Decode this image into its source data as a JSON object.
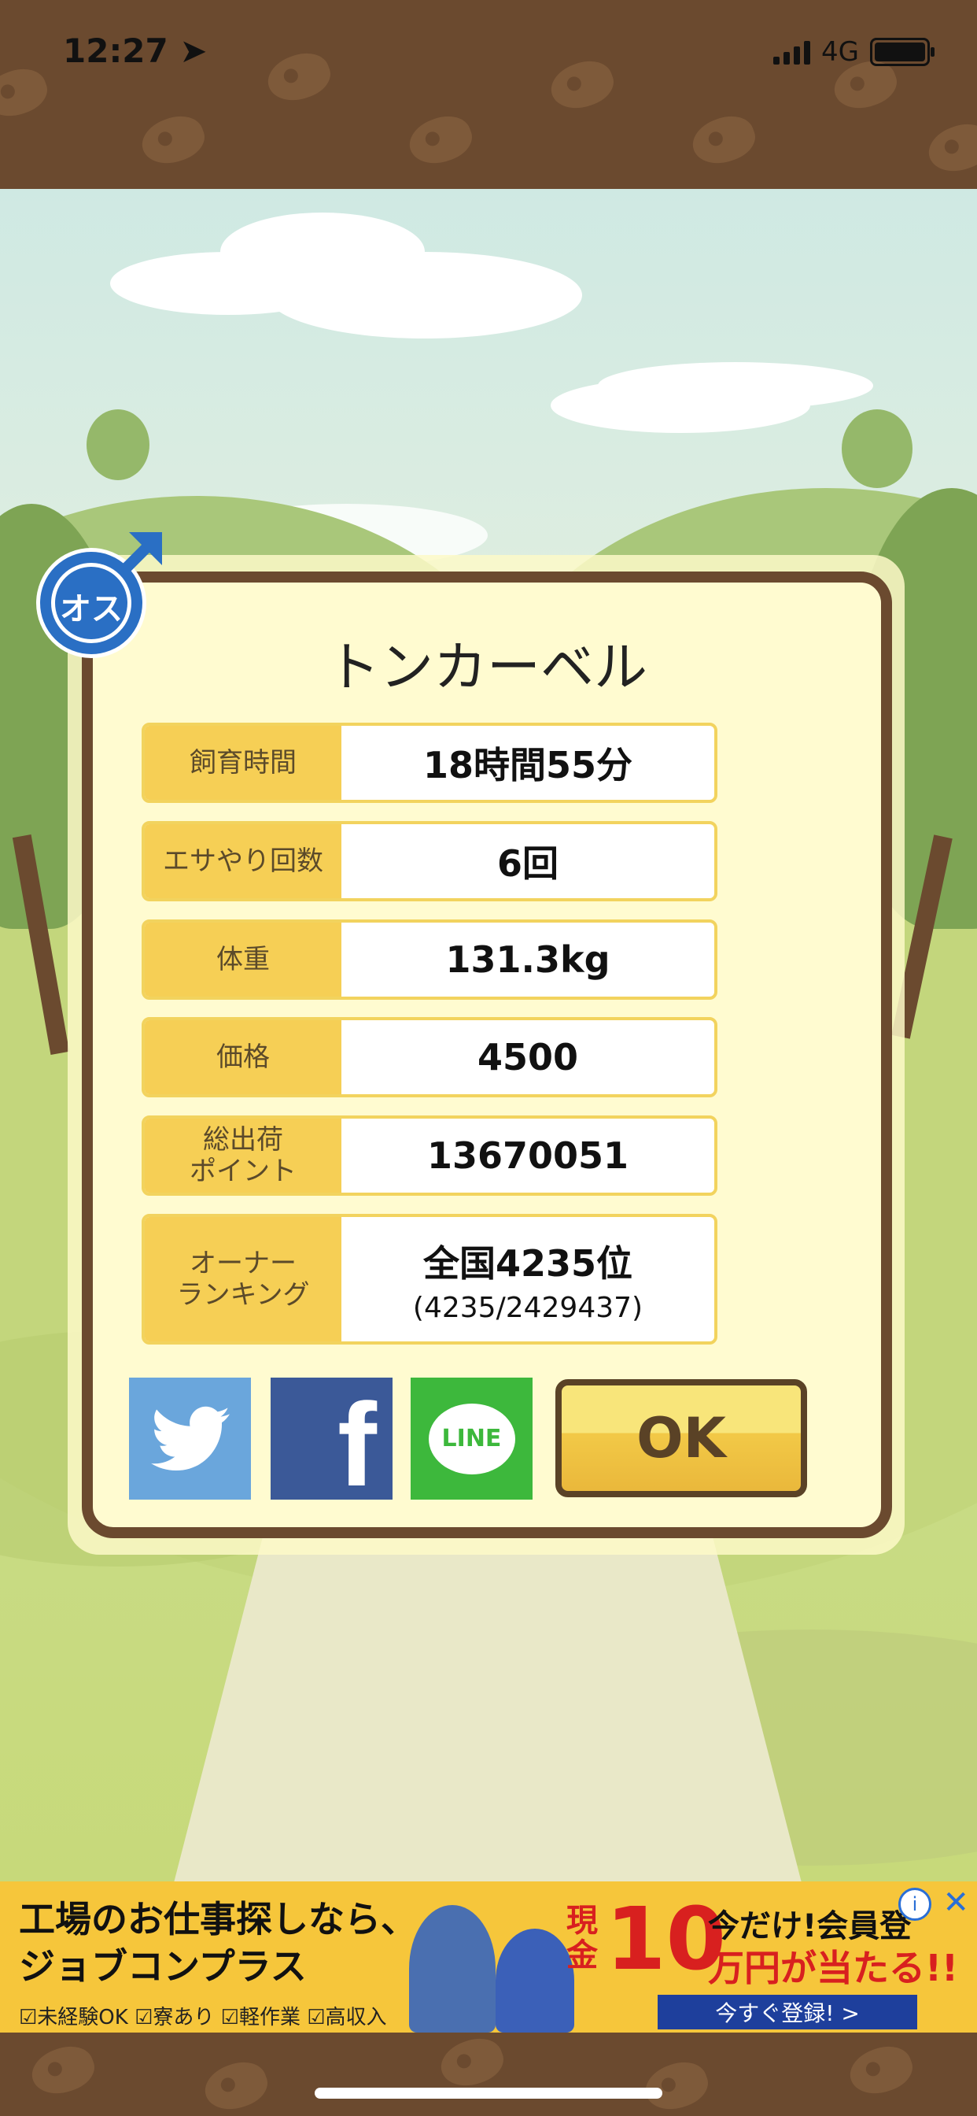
{
  "status_bar": {
    "time": "12:27",
    "network": "4G"
  },
  "dialog": {
    "title": "トンカーベル",
    "gender_badge": "オス",
    "rows": [
      {
        "label": "飼育時間",
        "value": "18時間55分"
      },
      {
        "label": "エサやり回数",
        "value": "6回"
      },
      {
        "label": "体重",
        "value": "131.3kg"
      },
      {
        "label": "価格",
        "value": "4500"
      },
      {
        "label": "総出荷\nポイント",
        "value": "13670051"
      },
      {
        "label": "オーナー\nランキング",
        "value": "全国4235位",
        "sub": "(4235/2429437)"
      }
    ],
    "share_buttons": [
      {
        "name": "twitter",
        "icon": "twitter-bird-icon",
        "color": "#6aa6dc"
      },
      {
        "name": "facebook",
        "label": "f",
        "icon": "facebook-icon",
        "color": "#3b5998"
      },
      {
        "name": "line",
        "label": "LINE",
        "icon": "line-icon",
        "color": "#3db83c"
      }
    ],
    "ok_label": "OK"
  },
  "ad": {
    "headline_1": "工場のお仕事探しなら、",
    "headline_2": "ジョブコンプラス",
    "badges": "☑未経験OK ☑寮あり ☑軽作業 ☑高収入",
    "genkin": "現\n金",
    "amount": "10",
    "line1": "今だけ!会員登",
    "line2": "万円が当たる!!",
    "cta": "今すぐ登録! >",
    "info": "i",
    "close": "✕"
  },
  "colors": {
    "accent_yellow": "#f6cf55",
    "border_brown": "#6b4a2f",
    "dialog_bg": "#fffbd0"
  }
}
